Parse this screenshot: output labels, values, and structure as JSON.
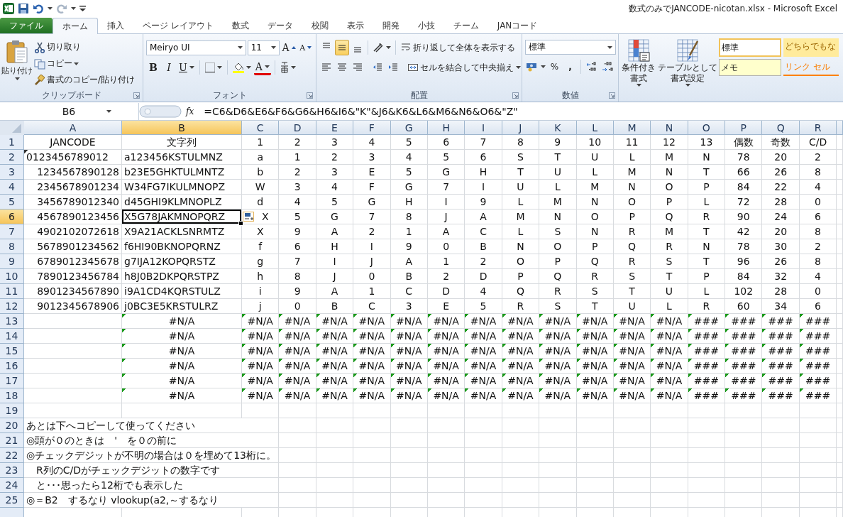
{
  "window": {
    "title": "数式のみでJANCODE-nicotan.xlsx  -  Microsoft Excel"
  },
  "tabs": [
    {
      "label": "ファイル",
      "kind": "file",
      "selected": false
    },
    {
      "label": "ホーム",
      "kind": "tab",
      "selected": true
    },
    {
      "label": "挿入",
      "kind": "tab",
      "selected": false
    },
    {
      "label": "ページ レイアウト",
      "kind": "tab",
      "selected": false
    },
    {
      "label": "数式",
      "kind": "tab",
      "selected": false
    },
    {
      "label": "データ",
      "kind": "tab",
      "selected": false
    },
    {
      "label": "校閲",
      "kind": "tab",
      "selected": false
    },
    {
      "label": "表示",
      "kind": "tab",
      "selected": false
    },
    {
      "label": "開発",
      "kind": "tab",
      "selected": false
    },
    {
      "label": "小技",
      "kind": "tab",
      "selected": false
    },
    {
      "label": "チーム",
      "kind": "tab",
      "selected": false
    },
    {
      "label": "JANコード",
      "kind": "tab",
      "selected": false
    }
  ],
  "ribbon": {
    "clipboard": {
      "paste": "貼り付け",
      "cut": "切り取り",
      "copy": "コピー",
      "format_painter": "書式のコピー/貼り付け",
      "label": "クリップボード"
    },
    "font": {
      "name": "Meiryo UI",
      "size": "11",
      "grow": "A",
      "shrink": "A",
      "bold": "B",
      "italic": "I",
      "underline": "U",
      "font_color": "A",
      "label": "フォント"
    },
    "alignment": {
      "vertical": [
        {
          "kind": "top",
          "selected": false
        },
        {
          "kind": "middle",
          "selected": true
        },
        {
          "kind": "bottom",
          "selected": false
        }
      ],
      "horizontal": [
        {
          "kind": "left",
          "selected": false
        },
        {
          "kind": "center",
          "selected": false
        },
        {
          "kind": "right",
          "selected": false
        }
      ],
      "wrap": "折り返して全体を表示する",
      "merge": "セルを結合して中央揃え",
      "label": "配置"
    },
    "number": {
      "format": "標準",
      "percent": "%",
      "comma": ",",
      "label": "数値"
    },
    "styles": {
      "conditional_format": [
        "条件付き",
        "書式"
      ],
      "format_as_table": [
        "テーブルとして",
        "書式設定"
      ],
      "cell_styles": [
        {
          "text": "標準",
          "kind": "normal"
        },
        {
          "text": "どちらでもな",
          "kind": "neutral"
        },
        {
          "text": "メモ",
          "kind": "note"
        },
        {
          "text": "リンク セル",
          "kind": "linked"
        }
      ]
    }
  },
  "formula_bar": {
    "name_box": "B6",
    "fx": "fx",
    "formula": "=C6&D6&E6&F6&G6&H6&I6&\"K\"&J6&K6&L6&M6&N6&O6&\"Z\""
  },
  "sheet": {
    "columns": [
      {
        "label": "A",
        "selected": false
      },
      {
        "label": "B",
        "selected": true
      },
      {
        "label": "C",
        "selected": false
      },
      {
        "label": "D",
        "selected": false
      },
      {
        "label": "E",
        "selected": false
      },
      {
        "label": "F",
        "selected": false
      },
      {
        "label": "G",
        "selected": false
      },
      {
        "label": "H",
        "selected": false
      },
      {
        "label": "I",
        "selected": false
      },
      {
        "label": "J",
        "selected": false
      },
      {
        "label": "K",
        "selected": false
      },
      {
        "label": "L",
        "selected": false
      },
      {
        "label": "M",
        "selected": false
      },
      {
        "label": "N",
        "selected": false
      },
      {
        "label": "O",
        "selected": false
      },
      {
        "label": "P",
        "selected": false
      },
      {
        "label": "Q",
        "selected": false
      },
      {
        "label": "R",
        "selected": false
      }
    ],
    "rows": [
      {
        "number": "1",
        "selected": false,
        "kind": "header",
        "cells": [
          "JANCODE",
          "文字列",
          "1",
          "2",
          "3",
          "4",
          "5",
          "6",
          "7",
          "8",
          "9",
          "10",
          "11",
          "12",
          "13",
          "偶数",
          "奇数",
          "C/D"
        ]
      },
      {
        "number": "2",
        "selected": false,
        "kind": "data",
        "cells": [
          {
            "text": "0123456789012",
            "kind": "text"
          },
          "a123456KSTULMNZ",
          "a",
          "1",
          "2",
          "3",
          "4",
          "5",
          "6",
          "S",
          "T",
          "U",
          "L",
          "M",
          "N",
          "78",
          "20",
          "2"
        ]
      },
      {
        "number": "3",
        "selected": false,
        "kind": "data",
        "cells": [
          "1234567890128",
          "b23E5GHKTULMNTZ",
          "b",
          "2",
          "3",
          "E",
          "5",
          "G",
          "H",
          "T",
          "U",
          "L",
          "M",
          "N",
          "T",
          "66",
          "26",
          "8"
        ]
      },
      {
        "number": "4",
        "selected": false,
        "kind": "data",
        "cells": [
          "2345678901234",
          "W34FG7IKULMNOPZ",
          "W",
          "3",
          "4",
          "F",
          "G",
          "7",
          "I",
          "U",
          "L",
          "M",
          "N",
          "O",
          "P",
          "84",
          "22",
          "4"
        ]
      },
      {
        "number": "5",
        "selected": false,
        "kind": "data",
        "cells": [
          "3456789012340",
          "d45GHI9KLMNOPLZ",
          "d",
          "4",
          "5",
          "G",
          "H",
          "I",
          "9",
          "L",
          "M",
          "N",
          "O",
          "P",
          "L",
          "72",
          "28",
          "0"
        ]
      },
      {
        "number": "6",
        "selected": true,
        "kind": "data",
        "cells": [
          "4567890123456",
          "X5G78JAKMNOPQRZ",
          "X",
          "5",
          "G",
          "7",
          "8",
          "J",
          "A",
          "M",
          "N",
          "O",
          "P",
          "Q",
          "R",
          "90",
          "24",
          "6"
        ]
      },
      {
        "number": "7",
        "selected": false,
        "kind": "data",
        "cells": [
          "4902102072618",
          "X9A21ACKLSNRMTZ",
          "X",
          "9",
          "A",
          "2",
          "1",
          "A",
          "C",
          "L",
          "S",
          "N",
          "R",
          "M",
          "T",
          "42",
          "20",
          "8"
        ]
      },
      {
        "number": "8",
        "selected": false,
        "kind": "data",
        "cells": [
          "5678901234562",
          "f6HI90BKNOPQRNZ",
          "f",
          "6",
          "H",
          "I",
          "9",
          "0",
          "B",
          "N",
          "O",
          "P",
          "Q",
          "R",
          "N",
          "78",
          "30",
          "2"
        ]
      },
      {
        "number": "9",
        "selected": false,
        "kind": "data",
        "cells": [
          "6789012345678",
          "g7IJA12KOPQRSTZ",
          "g",
          "7",
          "I",
          "J",
          "A",
          "1",
          "2",
          "O",
          "P",
          "Q",
          "R",
          "S",
          "T",
          "96",
          "26",
          "8"
        ]
      },
      {
        "number": "10",
        "selected": false,
        "kind": "data",
        "cells": [
          "7890123456784",
          "h8J0B2DKPQRSTPZ",
          "h",
          "8",
          "J",
          "0",
          "B",
          "2",
          "D",
          "P",
          "Q",
          "R",
          "S",
          "T",
          "P",
          "84",
          "32",
          "4"
        ]
      },
      {
        "number": "11",
        "selected": false,
        "kind": "data",
        "cells": [
          "8901234567890",
          "i9A1CD4KQRSTULZ",
          "i",
          "9",
          "A",
          "1",
          "C",
          "D",
          "4",
          "Q",
          "R",
          "S",
          "T",
          "U",
          "L",
          "102",
          "28",
          "0"
        ]
      },
      {
        "number": "12",
        "selected": false,
        "kind": "data",
        "cells": [
          "9012345678906",
          "j0BC3E5KRSTULRZ",
          "j",
          "0",
          "B",
          "C",
          "3",
          "E",
          "5",
          "R",
          "S",
          "T",
          "U",
          "L",
          "R",
          "60",
          "34",
          "6"
        ]
      },
      {
        "number": "13",
        "selected": false,
        "kind": "error",
        "cells": [
          null,
          "#N/A",
          "#N/A",
          "#N/A",
          "#N/A",
          "#N/A",
          "#N/A",
          "#N/A",
          "#N/A",
          "#N/A",
          "#N/A",
          "#N/A",
          "#N/A",
          "#N/A",
          "###",
          "###",
          "###",
          "###"
        ]
      },
      {
        "number": "14",
        "selected": false,
        "kind": "error",
        "cells": [
          null,
          "#N/A",
          "#N/A",
          "#N/A",
          "#N/A",
          "#N/A",
          "#N/A",
          "#N/A",
          "#N/A",
          "#N/A",
          "#N/A",
          "#N/A",
          "#N/A",
          "#N/A",
          "###",
          "###",
          "###",
          "###"
        ]
      },
      {
        "number": "15",
        "selected": false,
        "kind": "error",
        "cells": [
          null,
          "#N/A",
          "#N/A",
          "#N/A",
          "#N/A",
          "#N/A",
          "#N/A",
          "#N/A",
          "#N/A",
          "#N/A",
          "#N/A",
          "#N/A",
          "#N/A",
          "#N/A",
          "###",
          "###",
          "###",
          "###"
        ]
      },
      {
        "number": "16",
        "selected": false,
        "kind": "error",
        "cells": [
          null,
          "#N/A",
          "#N/A",
          "#N/A",
          "#N/A",
          "#N/A",
          "#N/A",
          "#N/A",
          "#N/A",
          "#N/A",
          "#N/A",
          "#N/A",
          "#N/A",
          "#N/A",
          "###",
          "###",
          "###",
          "###"
        ]
      },
      {
        "number": "17",
        "selected": false,
        "kind": "error",
        "cells": [
          null,
          "#N/A",
          "#N/A",
          "#N/A",
          "#N/A",
          "#N/A",
          "#N/A",
          "#N/A",
          "#N/A",
          "#N/A",
          "#N/A",
          "#N/A",
          "#N/A",
          "#N/A",
          "###",
          "###",
          "###",
          "###"
        ]
      },
      {
        "number": "18",
        "selected": false,
        "kind": "error",
        "cells": [
          null,
          "#N/A",
          "#N/A",
          "#N/A",
          "#N/A",
          "#N/A",
          "#N/A",
          "#N/A",
          "#N/A",
          "#N/A",
          "#N/A",
          "#N/A",
          "#N/A",
          "#N/A",
          "###",
          "###",
          "###",
          "###"
        ]
      },
      {
        "number": "19",
        "selected": false,
        "kind": "blank"
      },
      {
        "number": "20",
        "selected": false,
        "kind": "note",
        "cells": [
          "あとは下へコピーして使ってください"
        ]
      },
      {
        "number": "21",
        "selected": false,
        "kind": "note",
        "cells": [
          "◎頭が０のときは　'　を０の前に"
        ]
      },
      {
        "number": "22",
        "selected": false,
        "kind": "note",
        "cells": [
          "◎チェックデジットが不明の場合は０を埋めて13桁に。"
        ]
      },
      {
        "number": "23",
        "selected": false,
        "kind": "note",
        "cells": [
          "　R列のC/Dがチェックデジットの数字です"
        ]
      },
      {
        "number": "24",
        "selected": false,
        "kind": "note",
        "cells": [
          "　と･･･思ったら12桁でも表示した"
        ]
      },
      {
        "number": "25",
        "selected": false,
        "kind": "note",
        "cells": [
          "◎＝B2　するなり vlookup(a2,～するなり"
        ]
      }
    ]
  }
}
